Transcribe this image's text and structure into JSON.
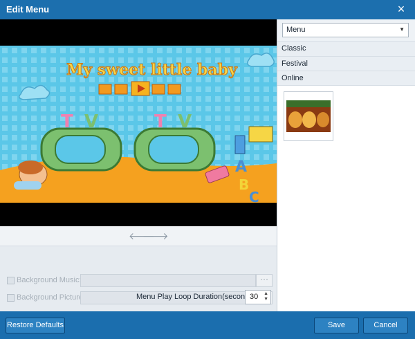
{
  "window": {
    "title": "Edit Menu",
    "close_glyph": "×"
  },
  "preview": {
    "headline": "My sweet little baby",
    "nav_prev": "🡐",
    "nav_next": "🡒"
  },
  "settings": {
    "background_music_label": "Background Music:",
    "background_music_value": "",
    "background_picture_label": "Background Picture:",
    "background_picture_value": "",
    "browse_label": "···",
    "loop_label": "Menu Play Loop Duration(seconds):",
    "loop_value": "30"
  },
  "sidebar": {
    "dropdown_value": "Menu",
    "categories": [
      "Classic",
      "Festival",
      "Online"
    ]
  },
  "footer": {
    "restore_label": "Restore Defaults",
    "save_label": "Save",
    "cancel_label": "Cancel"
  },
  "colors": {
    "title_bar": "#1c6fae",
    "button": "#2d82c2",
    "preview_sky": "#5bc7e8",
    "preview_ground": "#f5a11f"
  }
}
